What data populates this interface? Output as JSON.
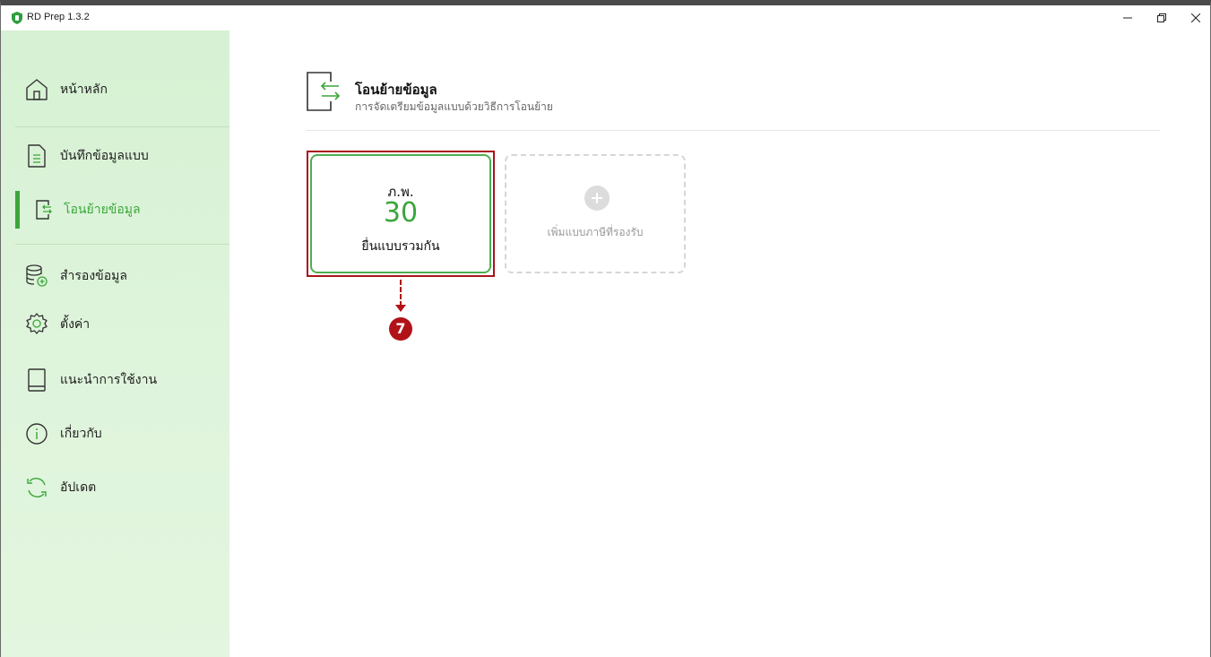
{
  "app": {
    "title": "RD Prep 1.3.2",
    "brand_color": "#3aa63a"
  },
  "window_controls": {
    "minimize": "minimize-icon",
    "restore": "restore-icon",
    "close": "close-icon"
  },
  "sidebar": {
    "items": [
      {
        "label": "หน้าหลัก",
        "icon": "home-icon"
      },
      {
        "label": "บันทึกข้อมูลแบบ",
        "icon": "document-icon"
      },
      {
        "label": "โอนย้ายข้อมูล",
        "icon": "transfer-icon",
        "active": true
      },
      {
        "label": "สำรองข้อมูล",
        "icon": "database-add-icon"
      },
      {
        "label": "ตั้งค่า",
        "icon": "gear-icon"
      },
      {
        "label": "แนะนำการใช้งาน",
        "icon": "book-icon"
      },
      {
        "label": "เกี่ยวกับ",
        "icon": "info-icon"
      },
      {
        "label": "อัปเดต",
        "icon": "refresh-icon"
      }
    ]
  },
  "main": {
    "title": "โอนย้ายข้อมูล",
    "subtitle": "การจัดเตรียมข้อมูลแบบด้วยวิธีการโอนย้าย",
    "form_card": {
      "form_type": "ภ.พ.",
      "number": "30",
      "caption": "ยื่นแบบรวมกัน"
    },
    "add_card": {
      "label": "เพิ่มแบบภาษีที่รองรับ",
      "icon": "plus-circle-icon"
    }
  },
  "annotation": {
    "step": "7",
    "color": "#b01217"
  }
}
